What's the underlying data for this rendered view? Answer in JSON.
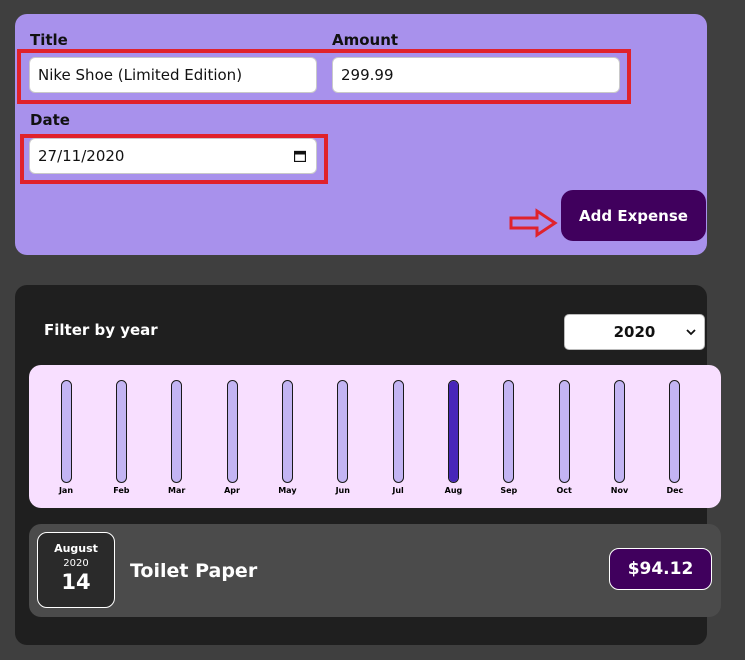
{
  "form": {
    "title_label": "Title",
    "title_value": "Nike Shoe (Limited Edition)",
    "amount_label": "Amount",
    "amount_value": "299.99",
    "date_label": "Date",
    "date_value": "27/11/2020",
    "add_button": "Add Expense"
  },
  "filter": {
    "label": "Filter by year",
    "selected_year": "2020"
  },
  "chart_data": {
    "type": "bar",
    "categories": [
      "Jan",
      "Feb",
      "Mar",
      "Apr",
      "May",
      "Jun",
      "Jul",
      "Aug",
      "Sep",
      "Oct",
      "Nov",
      "Dec"
    ],
    "values": [
      0,
      0,
      0,
      0,
      0,
      0,
      0,
      94.12,
      0,
      0,
      0,
      0
    ],
    "ylim": [
      0,
      94.12
    ]
  },
  "expenses": [
    {
      "month": "August",
      "year": "2020",
      "day": "14",
      "title": "Toilet Paper",
      "amount": "$94.12"
    }
  ],
  "colors": {
    "form_bg": "#a891ec",
    "accent": "#40005d",
    "annotation": "#e0222b",
    "bar_fill": "#4826b9",
    "bar_track": "#c3b4f3",
    "chart_bg": "#f8dfff"
  }
}
